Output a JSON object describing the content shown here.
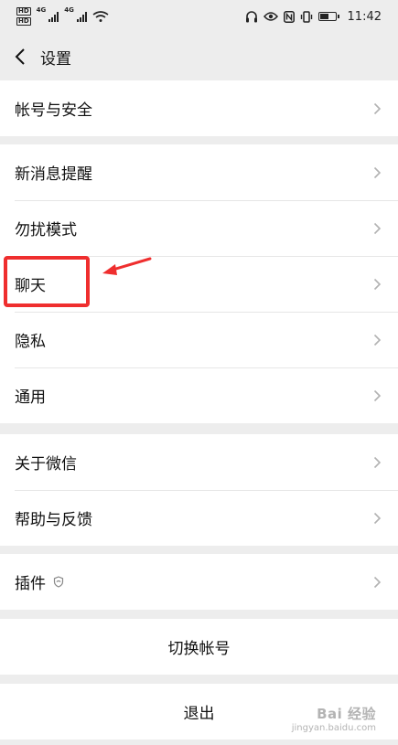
{
  "status_bar": {
    "sim1": "HD",
    "sim2": "HD",
    "net1": "4G",
    "net2": "4G",
    "time": "11:42"
  },
  "header": {
    "title": "设置"
  },
  "group1": {
    "items": [
      {
        "label": "帐号与安全"
      }
    ]
  },
  "group2": {
    "items": [
      {
        "label": "新消息提醒"
      },
      {
        "label": "勿扰模式"
      },
      {
        "label": "聊天"
      },
      {
        "label": "隐私"
      },
      {
        "label": "通用"
      }
    ]
  },
  "group3": {
    "items": [
      {
        "label": "关于微信"
      },
      {
        "label": "帮助与反馈"
      }
    ]
  },
  "group4": {
    "items": [
      {
        "label": "插件"
      }
    ]
  },
  "actions": {
    "switch_account": "切换帐号",
    "logout": "退出"
  },
  "annotation": {
    "color": "#ef2e2e"
  },
  "watermark": {
    "brand": "Bai 经验",
    "url": "jingyan.baidu.com"
  }
}
